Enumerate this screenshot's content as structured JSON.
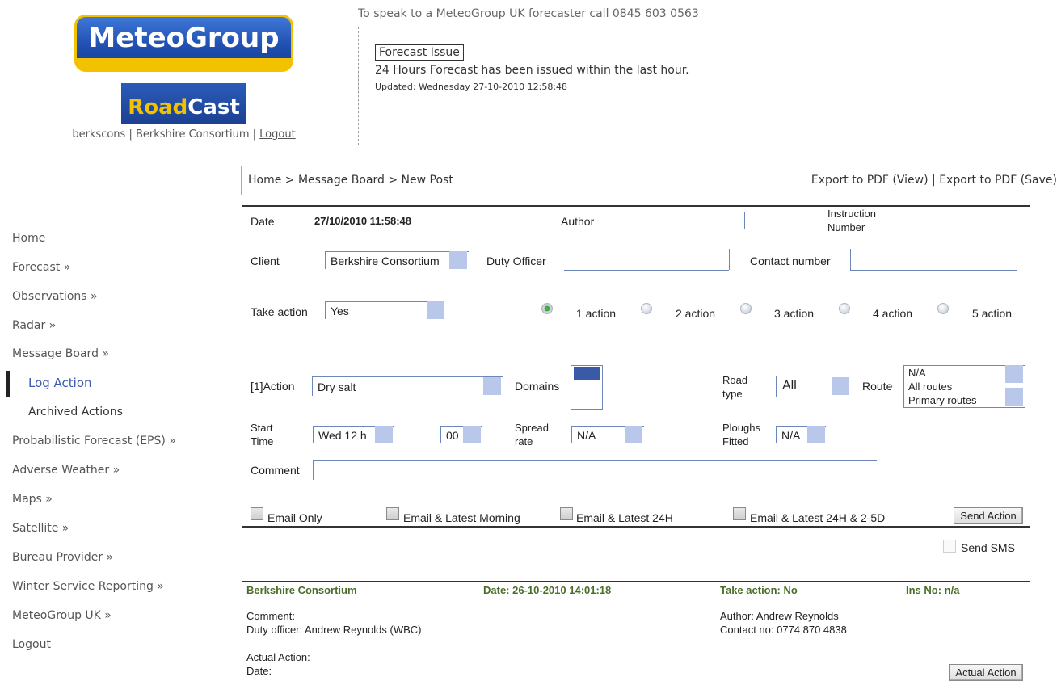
{
  "header": {
    "logo_text": "MeteoGroup",
    "roadcast_part1": "Road",
    "roadcast_part2": "Cast",
    "user_text": "berkscons | Berkshire Consortium | ",
    "logout_link": "Logout",
    "phone_text": "To speak to a MeteoGroup UK forecaster call 0845 603 0563",
    "forecast_title": "Forecast Issue",
    "forecast_text": "24 Hours Forecast has been issued within the last hour.",
    "forecast_updated": "Updated: Wednesday 27-10-2010 12:58:48"
  },
  "breadcrumb": {
    "path": "Home > Message Board > New Post",
    "export": "Export to PDF (View) | Export to PDF (Save)"
  },
  "sidebar": {
    "items": [
      {
        "label": "Home"
      },
      {
        "label": "Forecast »"
      },
      {
        "label": "Observations »"
      },
      {
        "label": "Radar »"
      },
      {
        "label": "Message Board »"
      },
      {
        "label": "Log Action"
      },
      {
        "label": "Archived Actions"
      },
      {
        "label": "Probabilistic Forecast (EPS) »"
      },
      {
        "label": "Adverse Weather »"
      },
      {
        "label": "Maps »"
      },
      {
        "label": "Satellite »"
      },
      {
        "label": "Bureau Provider »"
      },
      {
        "label": "Winter Service Reporting »"
      },
      {
        "label": "MeteoGroup UK »"
      },
      {
        "label": "Logout"
      }
    ]
  },
  "form": {
    "date_label": "Date",
    "date_value": "27/10/2010 11:58:48",
    "author_label": "Author",
    "instruction_label_1": "Instruction",
    "instruction_label_2": "Number",
    "client_label": "Client",
    "client_value": "Berkshire Consortium",
    "duty_officer_label": "Duty Officer",
    "contact_label": "Contact number",
    "take_action_label": "Take action",
    "take_action_value": "Yes",
    "action_options": [
      "1 action",
      "2 action",
      "3 action",
      "4 action",
      "5 action"
    ],
    "action_label": "[1]Action",
    "action_value": "Dry salt",
    "domains_label": "Domains",
    "road_type_label_1": "Road",
    "road_type_label_2": "type",
    "road_type_value": "All",
    "route_label": "Route",
    "route_options": [
      "N/A",
      "All routes",
      "Primary routes"
    ],
    "start_time_label_1": "Start",
    "start_time_label_2": "Time",
    "start_hour_value": "Wed 12 h",
    "start_min_value": "00",
    "spread_label_1": "Spread",
    "spread_label_2": "rate",
    "spread_value": "N/A",
    "ploughs_label_1": "Ploughs",
    "ploughs_label_2": "Fitted",
    "ploughs_value": "N/A",
    "comment_label": "Comment",
    "email_options": [
      "Email Only",
      "Email & Latest Morning",
      "Email & Latest 24H",
      "Email & Latest 24H & 2-5D"
    ],
    "send_action_button": "Send Action",
    "send_sms_label": "Send SMS"
  },
  "post": {
    "client": "Berkshire Consortium",
    "date": "Date: 26-10-2010 14:01:18",
    "take_action": "Take action: No",
    "ins_no": "Ins No: n/a",
    "comment": "Comment:",
    "duty_officer": "Duty officer: Andrew Reynolds (WBC)",
    "author": "Author: Andrew Reynolds",
    "contact": "Contact no: 0774 870 4838",
    "actual_action": "Actual Action:",
    "date_label": "Date:",
    "actual_action_button": "Actual Action"
  }
}
